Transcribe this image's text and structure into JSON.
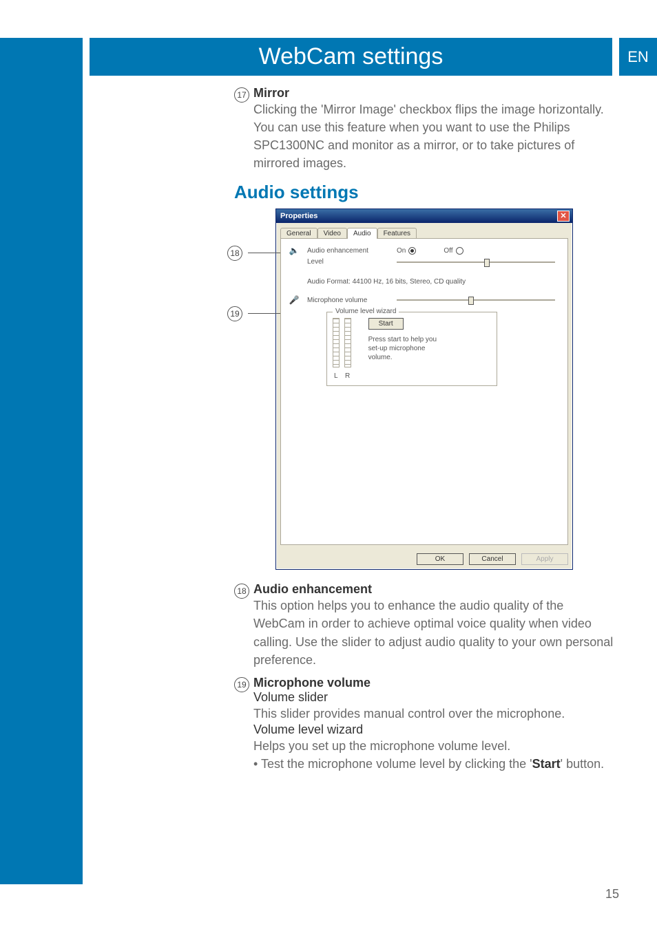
{
  "banner": {
    "title": "WebCam settings",
    "lang": "EN"
  },
  "page_number": "15",
  "item17": {
    "num": "17",
    "title": "Mirror",
    "text": "Clicking the 'Mirror Image' checkbox flips the image horizontally. You can use this feature when you want to use the Philips SPC1300NC and monitor as a mirror, or to take pictures of mirrored images."
  },
  "section_heading": "Audio settings",
  "dialog": {
    "title": "Properties",
    "tabs": {
      "general": "General",
      "video": "Video",
      "audio": "Audio",
      "features": "Features"
    },
    "audio_enhancement_label": "Audio enhancement",
    "level_label": "Level",
    "on_label": "On",
    "off_label": "Off",
    "audio_format": "Audio Format: 44100 Hz, 16 bits, Stereo, CD quality",
    "mic_volume_label": "Microphone volume",
    "wizard_legend": "Volume level wizard",
    "wizard_start": "Start",
    "wizard_l": "L",
    "wizard_r": "R",
    "wizard_text": "Press start to help you set-up microphone volume.",
    "ok": "OK",
    "cancel": "Cancel",
    "apply": "Apply"
  },
  "callouts": {
    "c18": "18",
    "c19": "19"
  },
  "item18": {
    "num": "18",
    "title": "Audio enhancement",
    "text": "This option helps you to enhance the audio quality of the WebCam in order to achieve optimal voice quality when video calling. Use the slider to adjust audio quality to your own personal preference."
  },
  "item19": {
    "num": "19",
    "title": "Microphone volume",
    "volume_slider_label": "Volume slider",
    "volume_slider_text": "This slider provides manual control over the microphone.",
    "wizard_label": "Volume level wizard",
    "wizard_text": "Helps you set up the microphone volume level.",
    "bullet_prefix": "• Test the microphone volume level by clicking the '",
    "bullet_bold": "Start",
    "bullet_suffix": "' button."
  }
}
